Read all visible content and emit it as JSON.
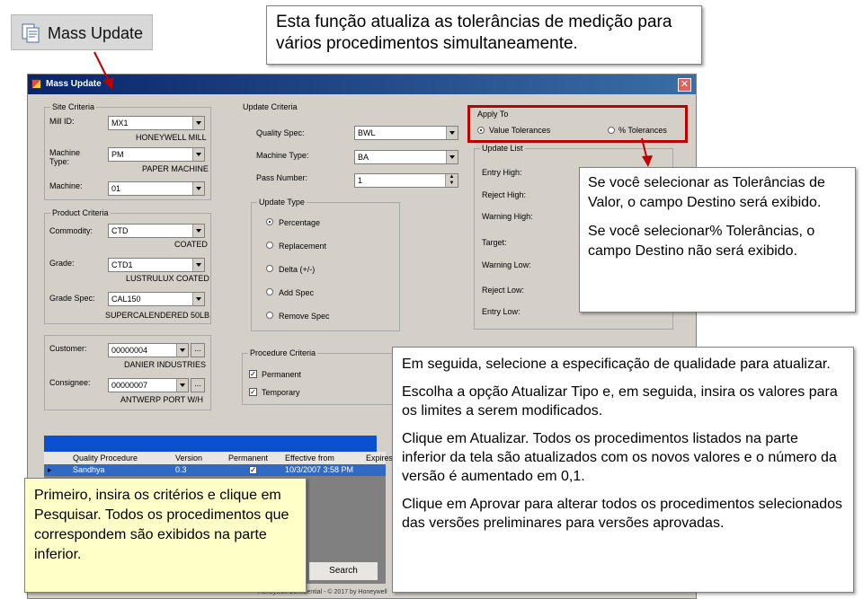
{
  "toolbar_button": {
    "label": "Mass Update"
  },
  "callouts": {
    "top": "Esta função atualiza as tolerâncias de medição para vários procedimentos simultaneamente.",
    "right_1": "Se você selecionar as Tolerâncias de Valor, o campo Destino será exibido.",
    "right_2": "Se você selecionar% Tolerâncias, o campo Destino não será exibido.",
    "bottom_right": [
      "Em seguida, selecione a especificação de qualidade para atualizar.",
      "Escolha a opção Atualizar Tipo e, em seguida, insira os valores para os limites a serem modificados.",
      "Clique em Atualizar. Todos os procedimentos listados na parte inferior da tela são atualizados com os novos valores e o número da versão é aumentado em 0,1.",
      "Clique em Aprovar para alterar todos os procedimentos selecionados das versões preliminares para versões aprovadas."
    ],
    "bottom_left": "Primeiro, insira os critérios e clique em Pesquisar. Todos os procedimentos que correspondem são exibidos na parte inferior."
  },
  "window": {
    "title": "Mass Update",
    "close": "✕",
    "site_criteria": {
      "title": "Site Criteria",
      "mill_label": "Mill ID:",
      "mill_value": "MX1",
      "mill_desc": "HONEYWELL MILL",
      "machine_type_label": "Machine Type:",
      "machine_type_value": "PM",
      "machine_type_desc": "PAPER MACHINE",
      "machine_label": "Machine:",
      "machine_value": "01"
    },
    "product_criteria": {
      "title": "Product Criteria",
      "commodity_label": "Commodity:",
      "commodity_value": "CTD",
      "commodity_desc": "COATED",
      "grade_label": "Grade:",
      "grade_value": "CTD1",
      "grade_desc": "LUSTRULUX COATED",
      "gradespec_label": "Grade Spec:",
      "gradespec_value": "CAL150",
      "gradespec_desc": "SUPERCALENDERED 50LB"
    },
    "customer": {
      "customer_label": "Customer:",
      "customer_value": "00000004",
      "customer_desc": "DANIER INDUSTRIES",
      "consignee_label": "Consignee:",
      "consignee_value": "00000007",
      "consignee_desc": "ANTWERP PORT W/H",
      "dots": "..."
    },
    "update_criteria": {
      "title": "Update Criteria",
      "quality_spec_label": "Quality Spec:",
      "quality_spec_value": "BWL",
      "machine_type_label": "Machine Type:",
      "machine_type_value": "BA",
      "pass_label": "Pass Number:",
      "pass_value": "1"
    },
    "update_type": {
      "title": "Update Type",
      "options": [
        "Percentage",
        "Replacement",
        "Delta (+/-)",
        "Add Spec",
        "Remove Spec"
      ],
      "selected": "Percentage"
    },
    "procedure_criteria": {
      "title": "Procedure Criteria",
      "permanent": "Permanent",
      "temporary": "Temporary",
      "check": "✓"
    },
    "apply_to": {
      "title": "Apply To",
      "value_tol": "Value Tolerances",
      "pct_tol": "% Tolerances"
    },
    "update_list": {
      "title": "Update List",
      "items": [
        "Entry High:",
        "Reject High:",
        "Warning High:",
        "Target:",
        "Warning Low:",
        "Reject Low:",
        "Entry Low:"
      ]
    },
    "grid": {
      "columns": [
        "Quality Procedure",
        "Version",
        "Permanent",
        "Effective from",
        "Expires"
      ],
      "row": {
        "procedure": "Sandhya",
        "version": "0.3",
        "effective": "10/3/2007 3:58 PM",
        "check": "✓"
      }
    },
    "search_button": "Search",
    "footer": "Honeywell Confidential - © 2017 by Honeywell"
  },
  "colors": {
    "highlight_red": "#c00000",
    "arrow_red": "#c00000",
    "title_blue": "#0a246a",
    "grid_blue": "#316ac5"
  }
}
